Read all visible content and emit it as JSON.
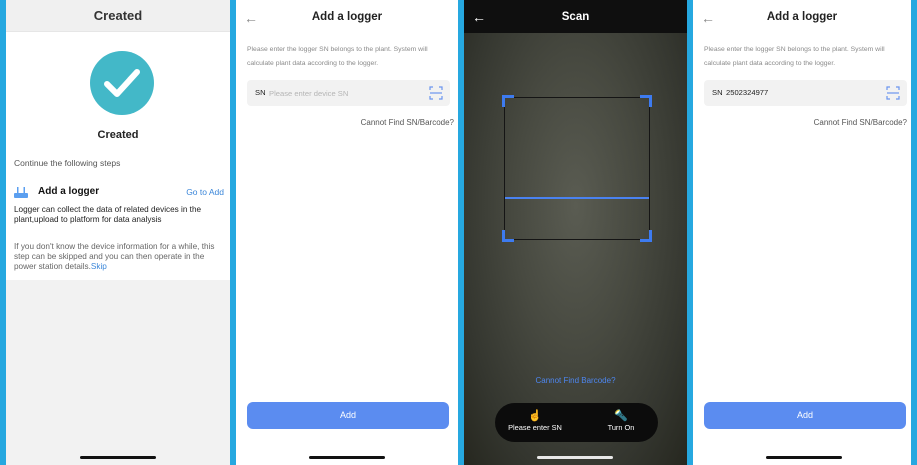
{
  "panel1": {
    "header_title": "Created",
    "status_label": "Created",
    "steps_label": "Continue the following steps",
    "logger_title": "Add a logger",
    "goto_label": "Go to Add",
    "logger_desc": "Logger can collect the data of related devices in the plant,upload to platform for data analysis",
    "skip_note": "If you don't know the device information for a while, this step can be skipped and you can then operate in the power station details.",
    "skip_label": "Skip"
  },
  "panel2": {
    "back_icon": "←",
    "title": "Add a logger",
    "hint": "Please enter the logger SN belongs to the plant. System will calculate plant data according to the logger.",
    "sn_prefix": "SN",
    "sn_placeholder": "Please enter device SN",
    "cannot_find": "Cannot Find SN/Barcode?",
    "add_label": "Add"
  },
  "panel3": {
    "back_icon": "←",
    "title": "Scan",
    "find_barcode": "Cannot Find Barcode?",
    "enter_sn_label": "Please enter SN",
    "torch_label": "Turn On",
    "enter_sn_icon": "☝",
    "torch_icon": "🔦"
  },
  "panel4": {
    "back_icon": "←",
    "title": "Add a logger",
    "hint": "Please enter the logger SN belongs to the plant. System will calculate plant data according to the logger.",
    "sn_prefix": "SN",
    "sn_value": "2502324977",
    "cannot_find": "Cannot Find SN/Barcode?",
    "add_label": "Add"
  },
  "colors": {
    "accent": "#5b8cf0",
    "link": "#3a86d9",
    "success": "#43b8c8",
    "frame_border": "#26a8e0"
  }
}
